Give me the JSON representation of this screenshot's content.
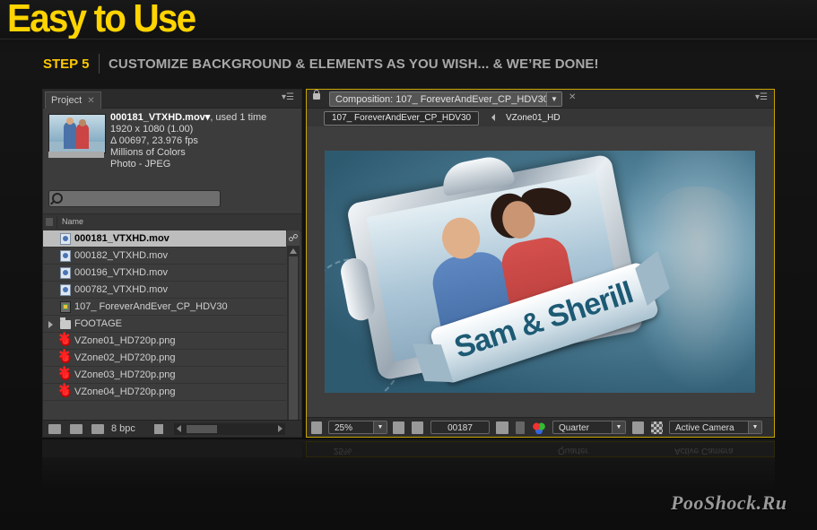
{
  "hero": {
    "title": "Easy to Use",
    "step_label": "STEP 5",
    "step_text": "CUSTOMIZE BACKGROUND & ELEMENTS AS YOU WISH... & WE’RE DONE!"
  },
  "project_panel": {
    "tab_label": "Project",
    "file_name": "000181_VTXHD.mov▾",
    "used": ", used 1 time",
    "resolution": "1920 x 1080 (1.00)",
    "duration": "Δ 00697, 23.976 fps",
    "colors": "Millions of Colors",
    "codec": "Photo - JPEG",
    "search_placeholder": "",
    "column_name": "Name",
    "items": [
      {
        "label": "000181_VTXHD.mov",
        "type": "mov",
        "selected": true
      },
      {
        "label": "000182_VTXHD.mov",
        "type": "mov"
      },
      {
        "label": "000196_VTXHD.mov",
        "type": "mov"
      },
      {
        "label": "000782_VTXHD.mov",
        "type": "mov"
      },
      {
        "label": "107_ ForeverAndEver_CP_HDV30",
        "type": "comp"
      },
      {
        "label": "FOOTAGE",
        "type": "folder"
      },
      {
        "label": "VZone01_HD720p.png",
        "type": "png"
      },
      {
        "label": "VZone02_HD720p.png",
        "type": "png"
      },
      {
        "label": "VZone03_HD720p.png",
        "type": "png"
      },
      {
        "label": "VZone04_HD720p.png",
        "type": "png"
      }
    ],
    "bpc": "8 bpc"
  },
  "comp_panel": {
    "tab_label": "Composition: 107_ ForeverAndEver_CP_HDV30",
    "crumb_comp": "107_ ForeverAndEver_CP_HDV30",
    "crumb_layer": "VZone01_HD",
    "ribbon_text": "Sam & Sherill",
    "zoom": "25%",
    "timecode": "00187",
    "resolution": "Quarter",
    "camera": "Active Camera"
  },
  "reflection": {
    "zoom": "25%",
    "resolution": "Quarter",
    "camera": "Active Camera"
  },
  "watermark": "PooShock.Ru",
  "colors": {
    "accent": "#ffd400",
    "panel": "#3c3c3c",
    "selection": "#bdbdbd",
    "comp_border": "#c8a600"
  }
}
